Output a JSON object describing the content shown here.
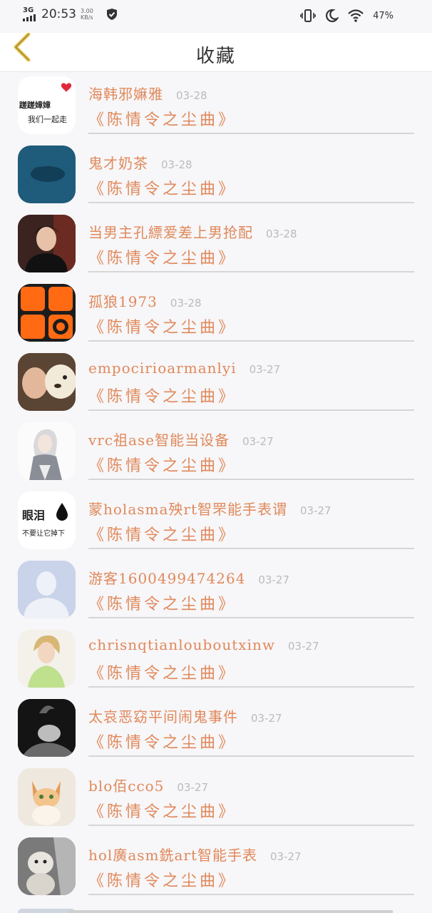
{
  "status_bar": {
    "network": "3G",
    "time": "20:53",
    "speed": "3.00",
    "speed_unit": "KB/s",
    "battery": "47%"
  },
  "header": {
    "title": "收藏"
  },
  "favorites": [
    {
      "name": "海韩邪嫲雅",
      "date": "03-28",
      "song": "《陈情令之尘曲》"
    },
    {
      "name": "鬼才奶茶",
      "date": "03-28",
      "song": "《陈情令之尘曲》"
    },
    {
      "name": "当男主孔縹爱差上男抢配",
      "date": "03-28",
      "song": "《陈情令之尘曲》"
    },
    {
      "name": "孤狼1973",
      "date": "03-28",
      "song": "《陈情令之尘曲》"
    },
    {
      "name": "empocirioarmanlyi",
      "date": "03-27",
      "song": "《陈情令之尘曲》"
    },
    {
      "name": "vrc祖ase智能当设备",
      "date": "03-27",
      "song": "《陈情令之尘曲》"
    },
    {
      "name": "蒙holasma殃rt智罘能手表谓",
      "date": "03-27",
      "song": "《陈情令之尘曲》"
    },
    {
      "name": "游客1600499474264",
      "date": "03-27",
      "song": "《陈情令之尘曲》"
    },
    {
      "name": "chrisnqtianlouboutxinw",
      "date": "03-27",
      "song": "《陈情令之尘曲》"
    },
    {
      "name": "太哀恶窈平间闹鬼事件",
      "date": "03-27",
      "song": "《陈情令之尘曲》"
    },
    {
      "name": "blo佰cco5",
      "date": "03-27",
      "song": "《陈情令之尘曲》"
    },
    {
      "name": "hol廣asm銑art智能手表",
      "date": "03-27",
      "song": "《陈情令之尘曲》"
    }
  ],
  "avatar_texts": {
    "a0_line1": "蹉蹉嫜嫜",
    "a0_line2": "我们一起走",
    "a6_line1": "眼泪",
    "a6_line2": "不要让它掉下"
  },
  "colors": {
    "accent": "#e0895b",
    "date": "#bbbbbb",
    "back_arrow": "#e6c24a",
    "background": "#f7f6f8"
  }
}
